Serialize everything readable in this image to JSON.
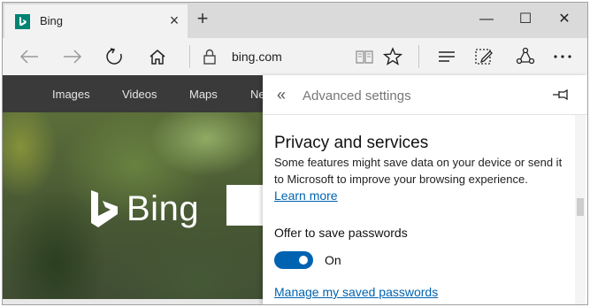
{
  "tab": {
    "title": "Bing",
    "favicon_letter": "b"
  },
  "window": {
    "minimize": "—",
    "maximize": "☐",
    "close": "✕"
  },
  "address": {
    "url": "bing.com"
  },
  "page": {
    "nav_links": [
      "Images",
      "Videos",
      "Maps",
      "Ne"
    ],
    "logo_text": "Bing"
  },
  "settings": {
    "back_glyph": "«",
    "title": "Advanced settings",
    "section_title": "Privacy and services",
    "section_desc": "Some features might save data on your device or send it to Microsoft to improve your browsing experience.",
    "learn_more": "Learn more",
    "offer_label": "Offer to save passwords",
    "toggle_state": "On",
    "manage_link": "Manage my saved passwords"
  },
  "colors": {
    "accent": "#0063b1",
    "bing_teal": "#008373",
    "nav_dark": "#3a3a3a"
  }
}
